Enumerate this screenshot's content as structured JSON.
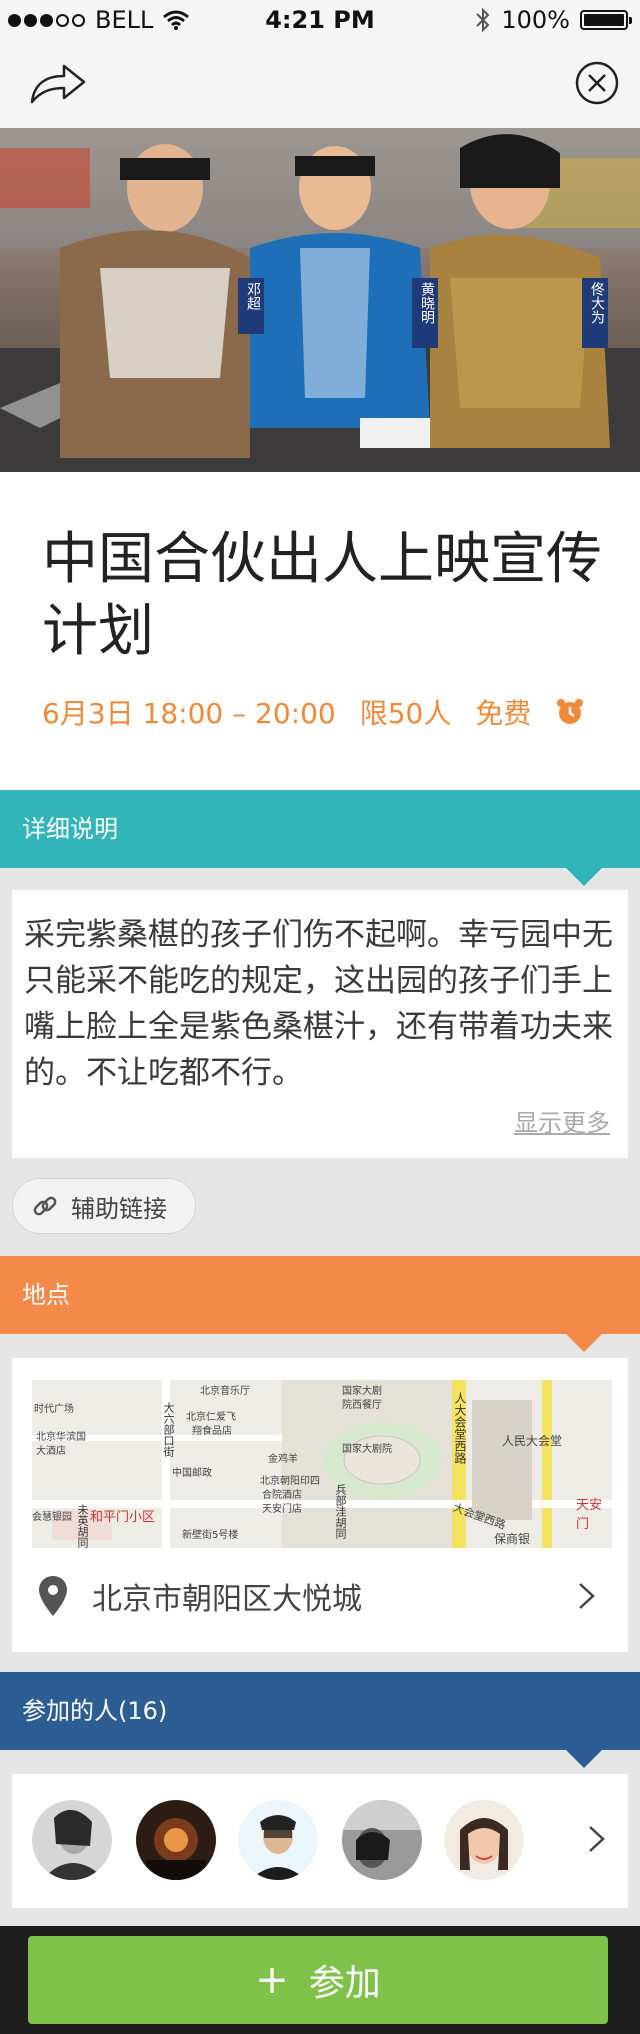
{
  "status_bar": {
    "carrier": "BELL",
    "time": "4:21 PM",
    "battery": "100%"
  },
  "nav": {
    "share_icon": "share-arrow-icon",
    "close_icon": "close-circle-icon"
  },
  "event": {
    "title": "中国合伙出人上映宣传计划",
    "date_time": "6月3日 18:00 – 20:00",
    "capacity": "限50人",
    "price": "免费",
    "accent": "#f08a3a"
  },
  "hero_overlay": {
    "name1": "邓超",
    "name2": "黄晓明",
    "name3": "佟大为"
  },
  "description": {
    "header": "详细说明",
    "text": "采完紫桑椹的孩子们伤不起啊。幸亏园中无只能采不能吃的规定，这出园的孩子们手上嘴上脸上全是紫色桑椹汁，还有带着功夫来的。不让吃都不行。",
    "more": "显示更多",
    "color": "#32b5b9"
  },
  "aux_link": {
    "label": "辅助链接"
  },
  "location": {
    "header": "地点",
    "address": "北京市朝阳区大悦城",
    "color": "#f38a4a",
    "map_labels": {
      "l1": "北京音乐厅",
      "l2": "时代广场",
      "l3": "北京华滨国",
      "l4": "大酒店",
      "l5": "北京仁爱飞",
      "l6": "翔食品店",
      "l7": "中国邮政",
      "l8": "北京朝阳印四",
      "l9": "合院酒店",
      "l10": "天安门店",
      "l11": "国家大剧",
      "l12": "院西餐厅",
      "l13": "国家大剧院",
      "l14": "金鸡羊",
      "l15": "人民大会堂",
      "l16": "人大会堂西路",
      "l17": "大会堂西路",
      "l18": "保商银",
      "l19": "天安门",
      "l20": "和平门小区",
      "l21": "新壁街5号楼",
      "l22": "大六部口街",
      "l23": "兵部洼胡同",
      "l24": "未英胡同",
      "l25": "会慧银园"
    }
  },
  "participants": {
    "header": "参加的人(16)",
    "color": "#2c5e94",
    "avatar_icons": [
      "avatar-1",
      "avatar-2",
      "avatar-3",
      "avatar-4",
      "avatar-5"
    ]
  },
  "join": {
    "label": "参加",
    "plus": "+",
    "color": "#7fc24a"
  }
}
